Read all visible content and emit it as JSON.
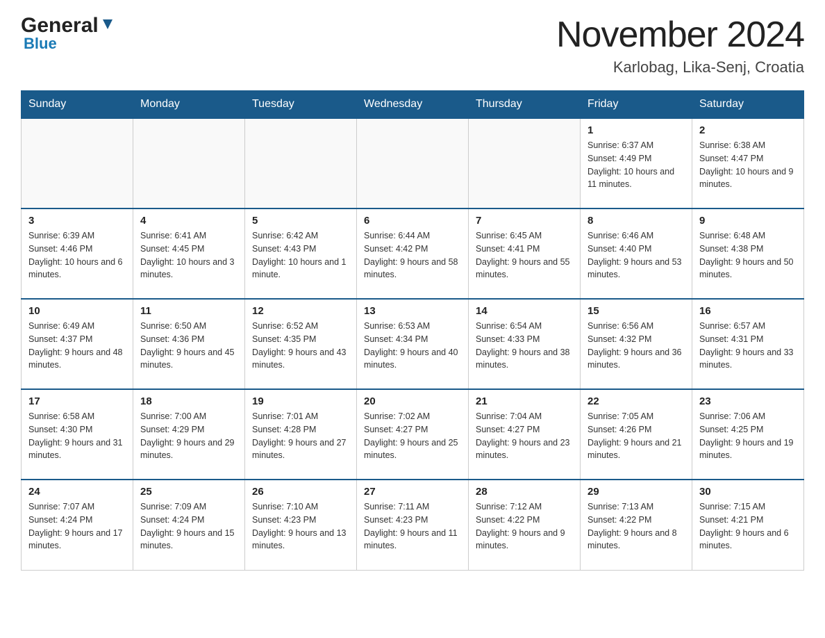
{
  "header": {
    "logo_general": "General",
    "logo_blue": "Blue",
    "month_title": "November 2024",
    "location": "Karlobag, Lika-Senj, Croatia"
  },
  "days_of_week": [
    "Sunday",
    "Monday",
    "Tuesday",
    "Wednesday",
    "Thursday",
    "Friday",
    "Saturday"
  ],
  "weeks": [
    [
      {
        "day": "",
        "info": ""
      },
      {
        "day": "",
        "info": ""
      },
      {
        "day": "",
        "info": ""
      },
      {
        "day": "",
        "info": ""
      },
      {
        "day": "",
        "info": ""
      },
      {
        "day": "1",
        "info": "Sunrise: 6:37 AM\nSunset: 4:49 PM\nDaylight: 10 hours and 11 minutes."
      },
      {
        "day": "2",
        "info": "Sunrise: 6:38 AM\nSunset: 4:47 PM\nDaylight: 10 hours and 9 minutes."
      }
    ],
    [
      {
        "day": "3",
        "info": "Sunrise: 6:39 AM\nSunset: 4:46 PM\nDaylight: 10 hours and 6 minutes."
      },
      {
        "day": "4",
        "info": "Sunrise: 6:41 AM\nSunset: 4:45 PM\nDaylight: 10 hours and 3 minutes."
      },
      {
        "day": "5",
        "info": "Sunrise: 6:42 AM\nSunset: 4:43 PM\nDaylight: 10 hours and 1 minute."
      },
      {
        "day": "6",
        "info": "Sunrise: 6:44 AM\nSunset: 4:42 PM\nDaylight: 9 hours and 58 minutes."
      },
      {
        "day": "7",
        "info": "Sunrise: 6:45 AM\nSunset: 4:41 PM\nDaylight: 9 hours and 55 minutes."
      },
      {
        "day": "8",
        "info": "Sunrise: 6:46 AM\nSunset: 4:40 PM\nDaylight: 9 hours and 53 minutes."
      },
      {
        "day": "9",
        "info": "Sunrise: 6:48 AM\nSunset: 4:38 PM\nDaylight: 9 hours and 50 minutes."
      }
    ],
    [
      {
        "day": "10",
        "info": "Sunrise: 6:49 AM\nSunset: 4:37 PM\nDaylight: 9 hours and 48 minutes."
      },
      {
        "day": "11",
        "info": "Sunrise: 6:50 AM\nSunset: 4:36 PM\nDaylight: 9 hours and 45 minutes."
      },
      {
        "day": "12",
        "info": "Sunrise: 6:52 AM\nSunset: 4:35 PM\nDaylight: 9 hours and 43 minutes."
      },
      {
        "day": "13",
        "info": "Sunrise: 6:53 AM\nSunset: 4:34 PM\nDaylight: 9 hours and 40 minutes."
      },
      {
        "day": "14",
        "info": "Sunrise: 6:54 AM\nSunset: 4:33 PM\nDaylight: 9 hours and 38 minutes."
      },
      {
        "day": "15",
        "info": "Sunrise: 6:56 AM\nSunset: 4:32 PM\nDaylight: 9 hours and 36 minutes."
      },
      {
        "day": "16",
        "info": "Sunrise: 6:57 AM\nSunset: 4:31 PM\nDaylight: 9 hours and 33 minutes."
      }
    ],
    [
      {
        "day": "17",
        "info": "Sunrise: 6:58 AM\nSunset: 4:30 PM\nDaylight: 9 hours and 31 minutes."
      },
      {
        "day": "18",
        "info": "Sunrise: 7:00 AM\nSunset: 4:29 PM\nDaylight: 9 hours and 29 minutes."
      },
      {
        "day": "19",
        "info": "Sunrise: 7:01 AM\nSunset: 4:28 PM\nDaylight: 9 hours and 27 minutes."
      },
      {
        "day": "20",
        "info": "Sunrise: 7:02 AM\nSunset: 4:27 PM\nDaylight: 9 hours and 25 minutes."
      },
      {
        "day": "21",
        "info": "Sunrise: 7:04 AM\nSunset: 4:27 PM\nDaylight: 9 hours and 23 minutes."
      },
      {
        "day": "22",
        "info": "Sunrise: 7:05 AM\nSunset: 4:26 PM\nDaylight: 9 hours and 21 minutes."
      },
      {
        "day": "23",
        "info": "Sunrise: 7:06 AM\nSunset: 4:25 PM\nDaylight: 9 hours and 19 minutes."
      }
    ],
    [
      {
        "day": "24",
        "info": "Sunrise: 7:07 AM\nSunset: 4:24 PM\nDaylight: 9 hours and 17 minutes."
      },
      {
        "day": "25",
        "info": "Sunrise: 7:09 AM\nSunset: 4:24 PM\nDaylight: 9 hours and 15 minutes."
      },
      {
        "day": "26",
        "info": "Sunrise: 7:10 AM\nSunset: 4:23 PM\nDaylight: 9 hours and 13 minutes."
      },
      {
        "day": "27",
        "info": "Sunrise: 7:11 AM\nSunset: 4:23 PM\nDaylight: 9 hours and 11 minutes."
      },
      {
        "day": "28",
        "info": "Sunrise: 7:12 AM\nSunset: 4:22 PM\nDaylight: 9 hours and 9 minutes."
      },
      {
        "day": "29",
        "info": "Sunrise: 7:13 AM\nSunset: 4:22 PM\nDaylight: 9 hours and 8 minutes."
      },
      {
        "day": "30",
        "info": "Sunrise: 7:15 AM\nSunset: 4:21 PM\nDaylight: 9 hours and 6 minutes."
      }
    ]
  ]
}
